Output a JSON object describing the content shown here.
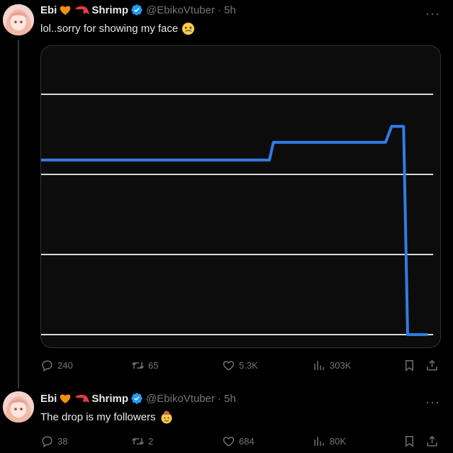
{
  "tweets": [
    {
      "display_name": "Ebi",
      "name_emojis": [
        "orange-heart",
        "shrimp"
      ],
      "name_suffix": "Shrimp",
      "handle": "@EbikoVtuber",
      "sep": "·",
      "time": "5h",
      "more": "···",
      "text": "lol..sorry for showing my face",
      "text_emoji": "face-holding-back-tears",
      "stats": {
        "replies": "240",
        "reposts": "65",
        "likes": "5.3K",
        "views": "303K"
      }
    },
    {
      "display_name": "Ebi",
      "name_emojis": [
        "orange-heart",
        "shrimp"
      ],
      "name_suffix": "Shrimp",
      "handle": "@EbikoVtuber",
      "sep": "·",
      "time": "5h",
      "more": "···",
      "text": "The drop is my followers",
      "text_emoji": "cowboy-face",
      "stats": {
        "replies": "38",
        "reposts": "2",
        "likes": "684",
        "views": "80K"
      }
    }
  ],
  "colors": {
    "background": "#000000",
    "line": "#2f7de6",
    "grid": "#d9d9d9",
    "verified": "#1d9bf0",
    "muted": "#71767b"
  },
  "chart_data": {
    "type": "line",
    "title": "",
    "xlabel": "",
    "ylabel": "",
    "grid": "horizontal",
    "ylim": [
      0,
      3
    ],
    "series": [
      {
        "x": [
          0,
          0.57,
          0.58,
          0.86,
          0.875,
          0.905,
          0.915,
          0.93,
          0.965
        ],
        "y": [
          2.18,
          2.18,
          2.4,
          2.4,
          2.6,
          2.6,
          0.0,
          0.0,
          0.0
        ]
      }
    ]
  }
}
